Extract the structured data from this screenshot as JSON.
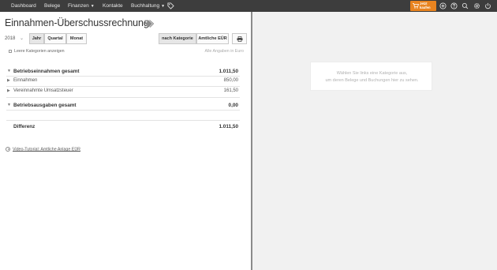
{
  "nav": {
    "items": [
      "Dashboard",
      "Belege",
      "Finanzen",
      "Kontakte",
      "Buchhaltung"
    ],
    "buy_label_1": "Jetzt",
    "buy_label_2": "kaufen",
    "icons": [
      "plus-circle-icon",
      "help-icon",
      "search-icon",
      "gear-icon",
      "power-icon"
    ]
  },
  "page": {
    "title": "Einnahmen-Überschussrechnung",
    "year": "2018",
    "period_tabs": [
      "Jahr",
      "Quartal",
      "Monat"
    ],
    "active_period": "Jahr",
    "view_tabs": [
      "nach Kategorie",
      "Amtliche EÜR"
    ],
    "active_view": "nach Kategorie",
    "checkbox_label": "Leere Kategorien anzeigen",
    "currency_note": "Alle Angaben in Euro"
  },
  "report": {
    "income_total_label": "Betriebseinnahmen gesamt",
    "income_total": "1.011,50",
    "income_rows": [
      {
        "label": "Einnahmen",
        "amount": "850,00"
      },
      {
        "label": "Vereinnahmte Umsatzsteuer",
        "amount": "161,50"
      }
    ],
    "expense_total_label": "Betriebsausgaben gesamt",
    "expense_total": "0,00",
    "difference_label": "Differenz",
    "difference": "1.011,50"
  },
  "video_link": "Video-Tutorial: Amtliche Anlage EÜR",
  "detail": {
    "line1": "Wählen Sie links eine Kategorie aus,",
    "line2": "um deren Belege und Buchungen hier zu sehen."
  },
  "colors": {
    "topbar": "#3d3d3d",
    "buy_button": "#e8831f",
    "detail_background": "#f1f1f1"
  }
}
